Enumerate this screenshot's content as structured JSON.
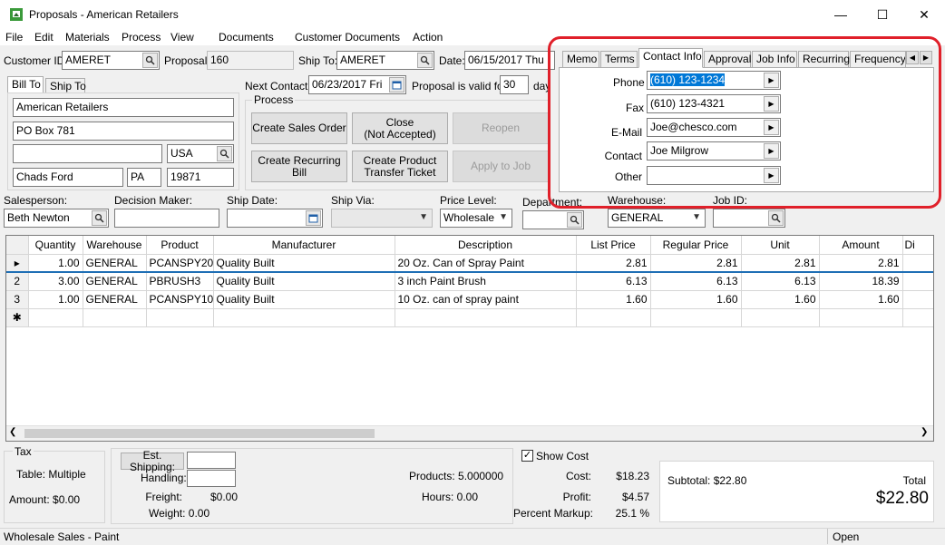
{
  "window": {
    "title": "Proposals - American Retailers",
    "min_glyph": "—",
    "max_glyph": "☐",
    "close_glyph": "✕"
  },
  "menu": [
    "File",
    "Edit",
    "Materials",
    "Process",
    "View",
    "Documents",
    "Customer Documents",
    "Action"
  ],
  "header": {
    "customer_id_label": "Customer ID:",
    "customer_id": "AMERET",
    "proposal_label": "Proposal:",
    "proposal": "160",
    "ship_to_label": "Ship To:",
    "ship_to": "AMERET",
    "date_label": "Date:",
    "date": "06/15/2017 Thu",
    "next_contact_label": "Next Contact:",
    "next_contact": "06/23/2017 Fri",
    "valid_label": "Proposal is valid for",
    "valid_days": "30",
    "days_label": "days"
  },
  "address_tabs": [
    "Bill To",
    "Ship To"
  ],
  "address": {
    "line1": "American Retailers",
    "line2": "PO Box 781",
    "line3": "",
    "country": "USA",
    "city": "Chads Ford",
    "state": "PA",
    "zip": "19871"
  },
  "process": {
    "label": "Process",
    "buttons": [
      "Create Sales Order",
      "Close\n(Not Accepted)",
      "Reopen",
      "Create Recurring Bill",
      "Create Product\nTransfer Ticket",
      "Apply to Job"
    ]
  },
  "info_tabs": [
    "Memo",
    "Terms",
    "Contact Info",
    "Approval",
    "Job Info",
    "Recurring",
    "Frequency"
  ],
  "contact_info": {
    "phone_label": "Phone",
    "phone": "(610) 123-1234",
    "fax_label": "Fax",
    "fax": "(610) 123-4321",
    "email_label": "E-Mail",
    "email": "Joe@chesco.com",
    "contact_label": "Contact",
    "contact": "Joe Milgrow",
    "other_label": "Other",
    "other": ""
  },
  "fields": {
    "salesperson_label": "Salesperson:",
    "salesperson": "Beth Newton",
    "decision_maker_label": "Decision Maker:",
    "decision_maker": "",
    "ship_date_label": "Ship Date:",
    "ship_date": "",
    "ship_via_label": "Ship Via:",
    "ship_via": "",
    "price_level_label": "Price Level:",
    "price_level": "Wholesale",
    "department_label": "Department:",
    "department": "",
    "warehouse_label": "Warehouse:",
    "warehouse": "GENERAL",
    "job_id_label": "Job ID:",
    "job_id": ""
  },
  "grid": {
    "columns": [
      "Quantity",
      "Warehouse",
      "Product",
      "Manufacturer",
      "Description",
      "List Price",
      "Regular Price",
      "Unit",
      "Amount",
      "Di"
    ],
    "rows": [
      {
        "rh": "▸",
        "cells": [
          "1.00",
          "GENERAL",
          "PCANSPY20",
          "Quality Built",
          "20 Oz. Can of Spray Paint",
          "2.81",
          "2.81",
          "2.81",
          "2.81",
          ""
        ]
      },
      {
        "rh": "2",
        "cells": [
          "3.00",
          "GENERAL",
          "PBRUSH3",
          "Quality Built",
          "3 inch Paint Brush",
          "6.13",
          "6.13",
          "6.13",
          "18.39",
          ""
        ]
      },
      {
        "rh": "3",
        "cells": [
          "1.00",
          "GENERAL",
          "PCANSPY10",
          "Quality Built",
          "10 Oz. can of spray paint",
          "1.60",
          "1.60",
          "1.60",
          "1.60",
          ""
        ]
      },
      {
        "rh": "✱",
        "cells": [
          "",
          "",
          "",
          "",
          "",
          "",
          "",
          "",
          "",
          ""
        ]
      }
    ]
  },
  "footer": {
    "tax_label": "Tax",
    "tax_table": "Table: Multiple",
    "tax_amount": "Amount: $0.00",
    "est_shipping_label": "Est. Shipping:",
    "handling_label": "Handling:",
    "freight_label": "Freight:",
    "freight": "$0.00",
    "weight": "Weight: 0.00",
    "products": "Products: 5.000000",
    "hours": "Hours: 0.00",
    "show_cost_label": "Show Cost",
    "cost_label": "Cost:",
    "cost": "$18.23",
    "profit_label": "Profit:",
    "profit": "$4.57",
    "markup_label": "Percent Markup:",
    "markup": "25.1 %",
    "subtotal": "Subtotal: $22.80",
    "total_label": "Total",
    "total": "$22.80"
  },
  "status": {
    "left": "Wholesale Sales - Paint",
    "right": "Open"
  },
  "colors": {
    "highlight_box": "#e0202a",
    "selection": "#0078d7",
    "app_icon": "#3a9a3a"
  }
}
